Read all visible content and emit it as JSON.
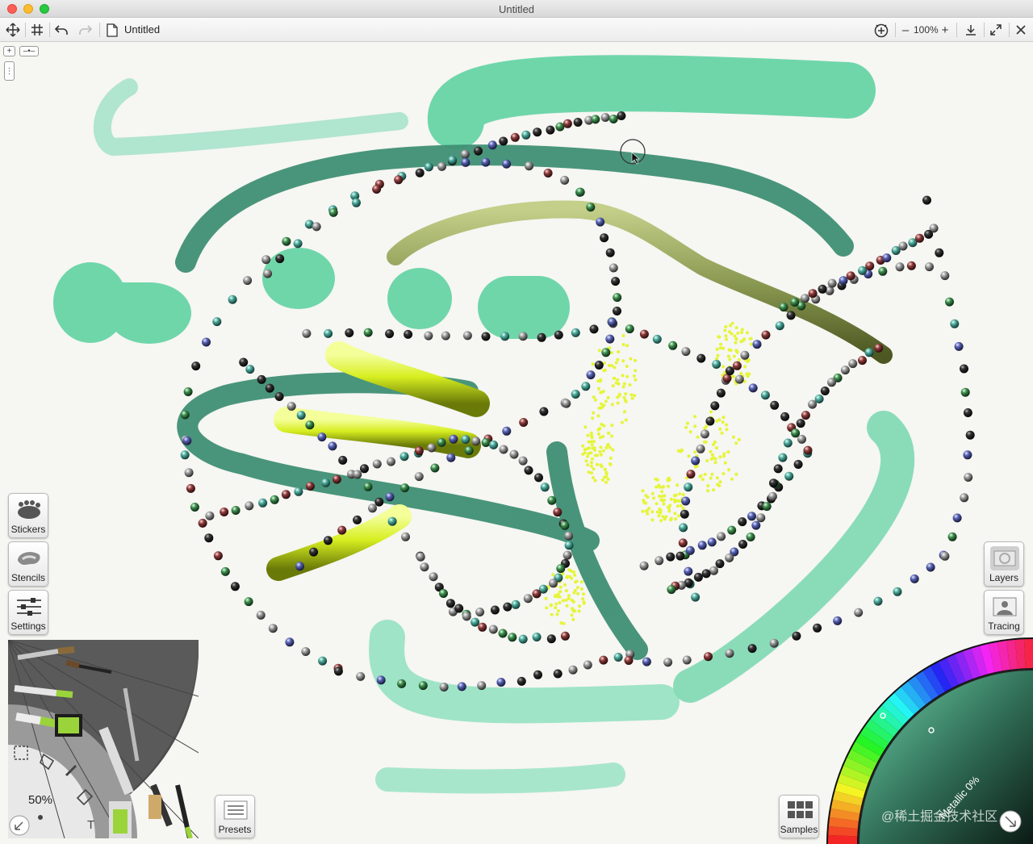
{
  "window": {
    "title": "Untitled"
  },
  "toolbar": {
    "document_name": "Untitled",
    "zoom": "100%",
    "icons": [
      "move-icon",
      "grid-icon",
      "undo-icon",
      "redo-icon",
      "document-icon",
      "record-icon",
      "zoom-out-icon",
      "zoom-in-icon",
      "download-icon",
      "fullscreen-icon",
      "close-icon"
    ]
  },
  "side_panels": {
    "stickers": "Stickers",
    "stencils": "Stencils",
    "settings": "Settings",
    "layers": "Layers",
    "tracing": "Tracing",
    "presets": "Presets",
    "samples": "Samples"
  },
  "tool_wheel": {
    "brush_size": "50%"
  },
  "color_wheel": {
    "metallic": "Metallic 0%"
  },
  "watermark": {
    "bottom_right": "@稀土掘金技术社区"
  },
  "colors": {
    "mint": "#6fd6aa",
    "dark_teal": "#3f8f74",
    "olive": "#8b9a52",
    "lime": "#d8ef2a",
    "canvas": "#f6f6f2"
  }
}
